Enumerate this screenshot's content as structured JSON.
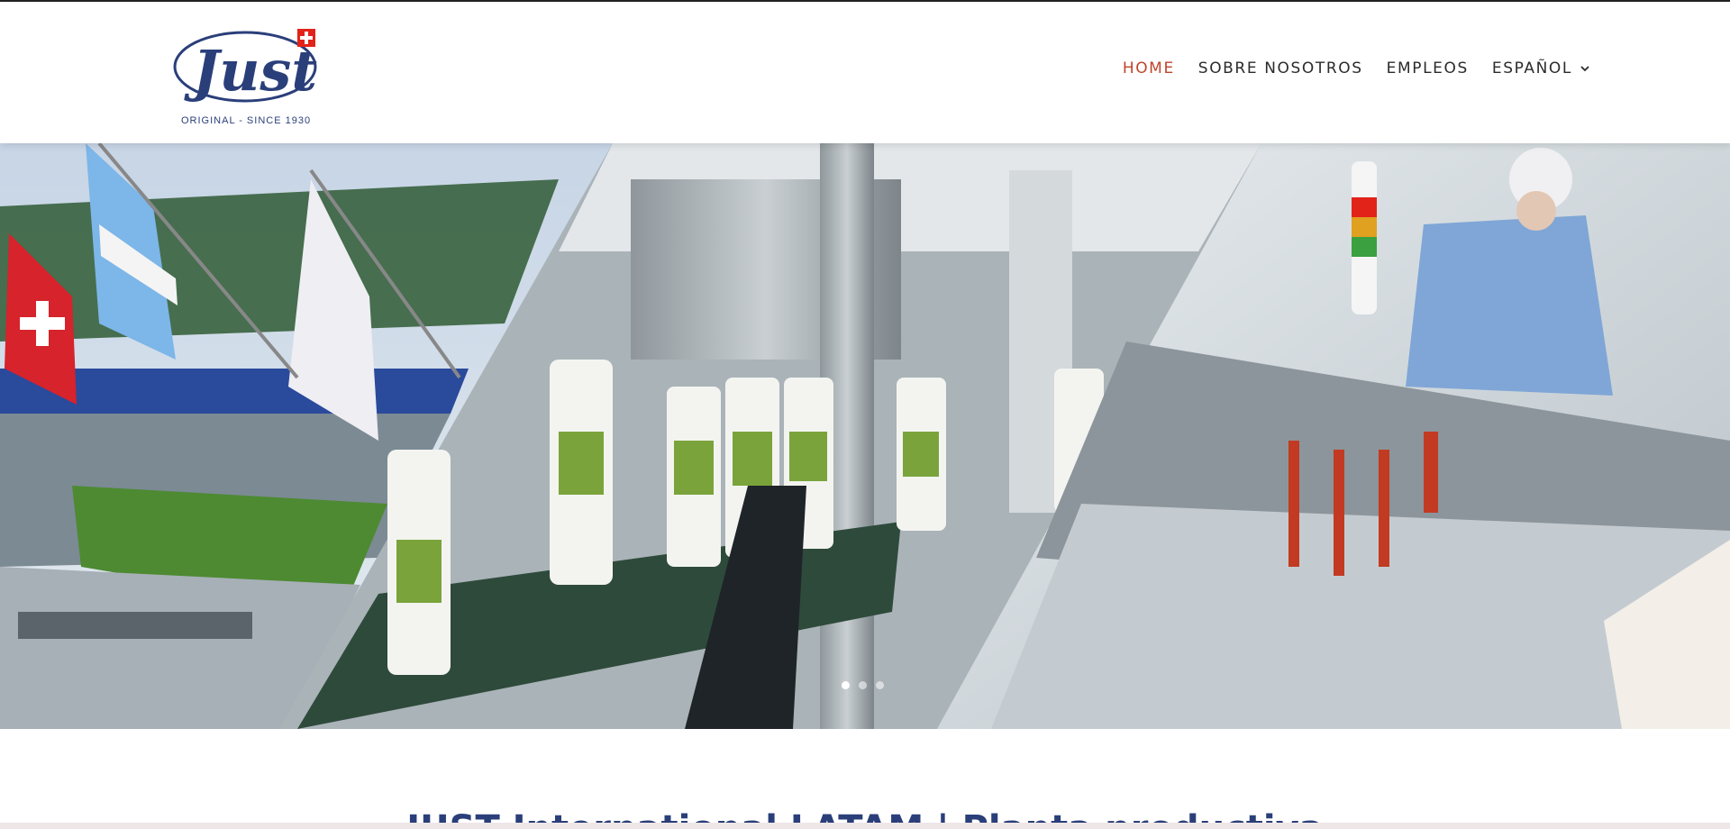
{
  "brand": {
    "logo_text": "Just",
    "tagline": "ORIGINAL - SINCE 1930"
  },
  "nav": {
    "items": [
      {
        "label": "HOME",
        "active": true
      },
      {
        "label": "SOBRE NOSOTROS",
        "active": false
      },
      {
        "label": "EMPLEOS",
        "active": false
      },
      {
        "label": "ESPAÑOL",
        "active": false,
        "has_dropdown": true
      }
    ]
  },
  "hero": {
    "slides_total": 3,
    "active_slide": 1
  },
  "section": {
    "heading": "JUST International LATAM | Planta productiva"
  },
  "colors": {
    "accent": "#c0452b",
    "brand_blue": "#2a3f7a",
    "swiss_red": "#e2231a"
  },
  "icons": {
    "dropdown": "chevron-down-icon"
  }
}
